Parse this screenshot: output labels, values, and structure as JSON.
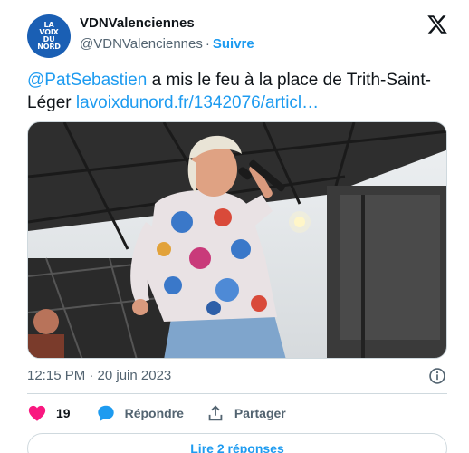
{
  "account": {
    "name": "VDNValenciennes",
    "handle": "@VDNValenciennes",
    "separator": "·",
    "follow_label": "Suivre",
    "avatar_lines": [
      "LA",
      "VOIX",
      "DU",
      "NORD"
    ]
  },
  "tweet": {
    "mention": "@PatSebastien",
    "text": " a mis le feu à la place de Trith-Saint-Léger ",
    "link": "lavoixdunord.fr/1342076/articl…",
    "timestamp": "12:15 PM · 20 juin 2023"
  },
  "actions": {
    "like_count": "19",
    "reply_label": "Répondre",
    "share_label": "Partager"
  },
  "replies_button": "Lire 2 réponses",
  "colors": {
    "accent": "#1d9bf0",
    "like": "#f91880",
    "text": "#0f1419",
    "secondary": "#536471",
    "border": "#cfd9de",
    "avatar": "#1a5fb4"
  }
}
